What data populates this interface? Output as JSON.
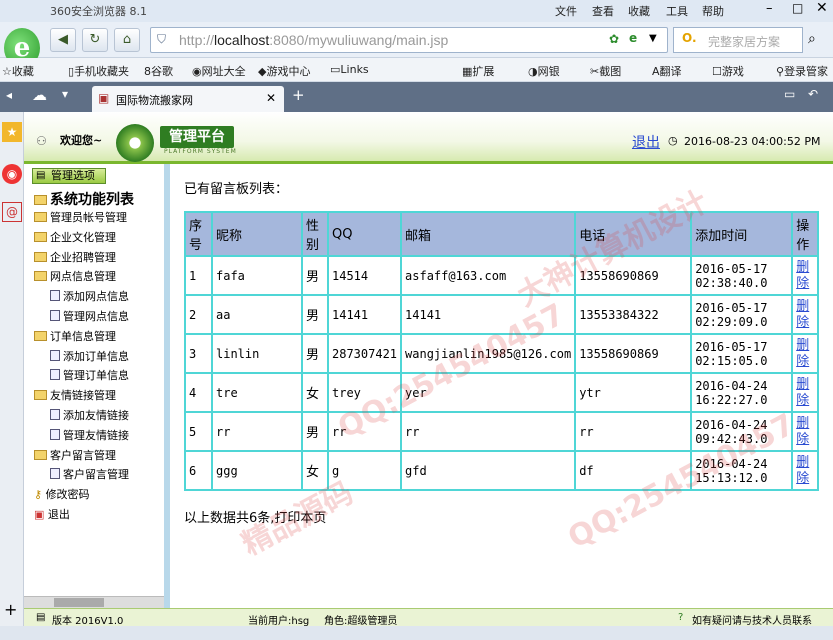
{
  "browser": {
    "title": "360安全浏览器 8.1",
    "menu": [
      "文件",
      "查看",
      "收藏",
      "工具",
      "帮助"
    ],
    "url_prefix": "http://",
    "url_host": "localhost",
    "url_rest": ":8080/mywuliuwang/main.jsp",
    "search_placeholder": "完整家居方案",
    "favorites": [
      "收藏",
      "手机收藏夹",
      "谷歌",
      "网址大全",
      "游戏中心",
      "Links",
      "扩展",
      "网银",
      "截图",
      "翻译",
      "游戏",
      "登录管家"
    ],
    "tab_label": "国际物流搬家网"
  },
  "app": {
    "welcome": "欢迎您~",
    "badge": "管理平台",
    "badge_sub": "PLATFORM SYSTEM",
    "logout": "退出",
    "datetime": "2016-08-23 04:00:52 PM",
    "panel_tab": "管理选项",
    "panel_title": "系统功能列表",
    "menu": [
      {
        "label": "管理员帐号管理",
        "type": "folder",
        "level": 0
      },
      {
        "label": "企业文化管理",
        "type": "folder",
        "level": 0
      },
      {
        "label": "企业招聘管理",
        "type": "folder",
        "level": 0
      },
      {
        "label": "网点信息管理",
        "type": "folder",
        "level": 0
      },
      {
        "label": "添加网点信息",
        "type": "doc",
        "level": 1
      },
      {
        "label": "管理网点信息",
        "type": "doc",
        "level": 1
      },
      {
        "label": "订单信息管理",
        "type": "folder",
        "level": 0
      },
      {
        "label": "添加订单信息",
        "type": "doc",
        "level": 1
      },
      {
        "label": "管理订单信息",
        "type": "doc",
        "level": 1
      },
      {
        "label": "友情链接管理",
        "type": "folder",
        "level": 0
      },
      {
        "label": "添加友情链接",
        "type": "doc",
        "level": 1
      },
      {
        "label": "管理友情链接",
        "type": "doc",
        "level": 1
      },
      {
        "label": "客户留言管理",
        "type": "folder",
        "level": 0
      },
      {
        "label": "客户留言管理",
        "type": "doc",
        "level": 1
      },
      {
        "label": "修改密码",
        "type": "key",
        "level": 0
      },
      {
        "label": "退出",
        "type": "exit",
        "level": 0
      }
    ]
  },
  "main": {
    "list_title": "已有留言板列表：",
    "columns": [
      "序号",
      "昵称",
      "性别",
      "QQ",
      "邮箱",
      "电话",
      "添加时间",
      "操作"
    ],
    "rows": [
      {
        "no": "1",
        "nick": "fafa",
        "sex": "男",
        "qq": "14514",
        "email": "asfaff@163.com",
        "phone": "13558690869",
        "date": "2016-05-17",
        "time": "02:38:40.0",
        "action": "删除"
      },
      {
        "no": "2",
        "nick": "aa",
        "sex": "男",
        "qq": "14141",
        "email": "14141",
        "phone": "13553384322",
        "date": "2016-05-17",
        "time": "02:29:09.0",
        "action": "删除"
      },
      {
        "no": "3",
        "nick": "linlin",
        "sex": "男",
        "qq": "287307421",
        "email": "wangjianlin1985@126.com",
        "phone": "13558690869",
        "date": "2016-05-17",
        "time": "02:15:05.0",
        "action": "删除"
      },
      {
        "no": "4",
        "nick": "tre",
        "sex": "女",
        "qq": "trey",
        "email": "yer",
        "phone": "ytr",
        "date": "2016-04-24",
        "time": "16:22:27.0",
        "action": "删除"
      },
      {
        "no": "5",
        "nick": "rr",
        "sex": "男",
        "qq": "rr",
        "email": "rr",
        "phone": "rr",
        "date": "2016-04-24",
        "time": "09:42:43.0",
        "action": "删除"
      },
      {
        "no": "6",
        "nick": "ggg",
        "sex": "女",
        "qq": "g",
        "email": "gfd",
        "phone": "df",
        "date": "2016-04-24",
        "time": "15:13:12.0",
        "action": "删除"
      }
    ],
    "summary": "以上数据共6条,打印本页"
  },
  "status": {
    "version": "版本 2016V1.0",
    "current_user": "当前用户:hsg",
    "role": "角色:超级管理员",
    "help": "如有疑问请与技术人员联系"
  },
  "watermarks": [
    "QQ:254540457",
    "大神计算机设计",
    "精品源码"
  ]
}
